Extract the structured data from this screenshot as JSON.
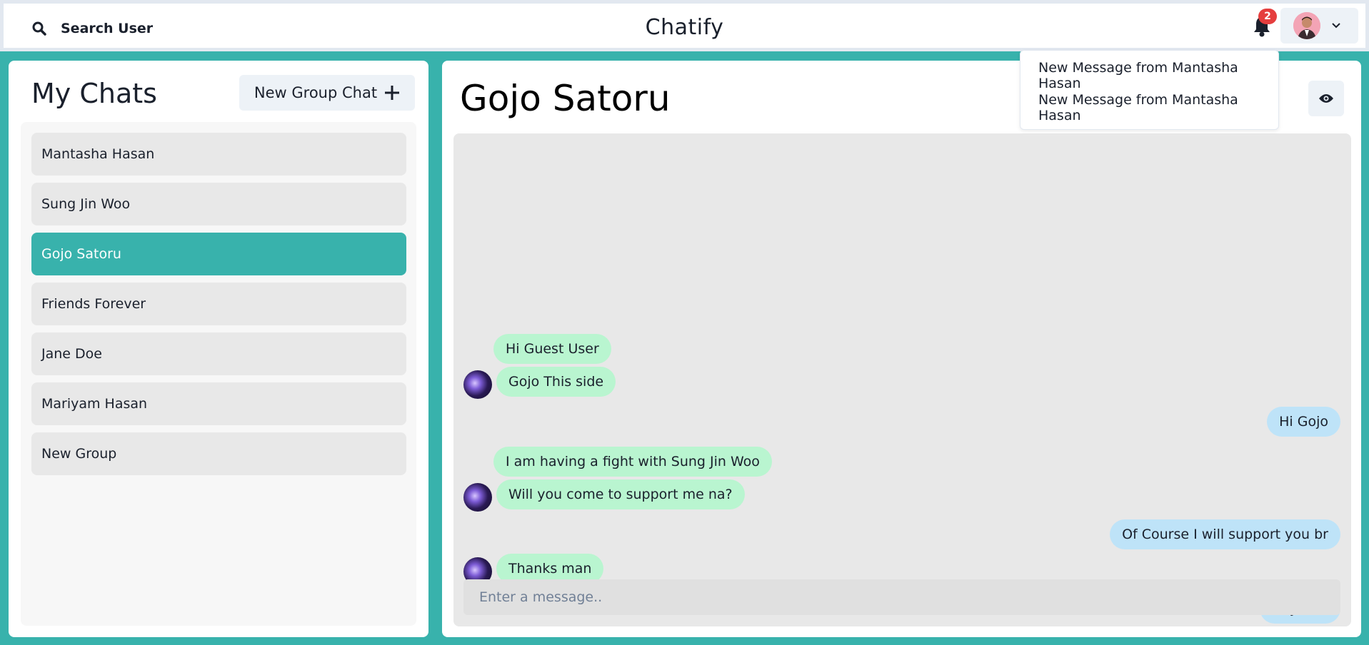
{
  "header": {
    "search_label": "Search User",
    "app_title": "Chatify",
    "notification_count": "2",
    "notifications": [
      "New Message from Mantasha Hasan",
      "New Message from Mantasha Hasan"
    ]
  },
  "sidebar": {
    "title": "My Chats",
    "new_group_label": "New Group Chat",
    "chats": [
      {
        "name": "Mantasha Hasan",
        "active": false
      },
      {
        "name": "Sung Jin Woo",
        "active": false
      },
      {
        "name": "Gojo Satoru",
        "active": true
      },
      {
        "name": "Friends Forever",
        "active": false
      },
      {
        "name": "Jane Doe",
        "active": false
      },
      {
        "name": "Mariyam Hasan",
        "active": false
      },
      {
        "name": "New Group",
        "active": false
      }
    ]
  },
  "chat": {
    "title": "Gojo Satoru",
    "messages": [
      {
        "text": "Hi Guest User",
        "dir": "in"
      },
      {
        "text": "Gojo This side",
        "dir": "in"
      },
      {
        "text": "Hi Gojo",
        "dir": "out"
      },
      {
        "text": "I am having a fight with Sung Jin Woo",
        "dir": "in"
      },
      {
        "text": "Will you come to support me na?",
        "dir": "in"
      },
      {
        "text": "Of Course I will support you br",
        "dir": "out"
      },
      {
        "text": "Thanks man",
        "dir": "in"
      },
      {
        "text": "Anytime",
        "dir": "out"
      }
    ],
    "input_placeholder": "Enter a message.."
  },
  "colors": {
    "accent": "#38b2ac",
    "incoming_bubble": "#b9f5d0",
    "outgoing_bubble": "#bee3f8",
    "badge": "#e53e3e"
  }
}
